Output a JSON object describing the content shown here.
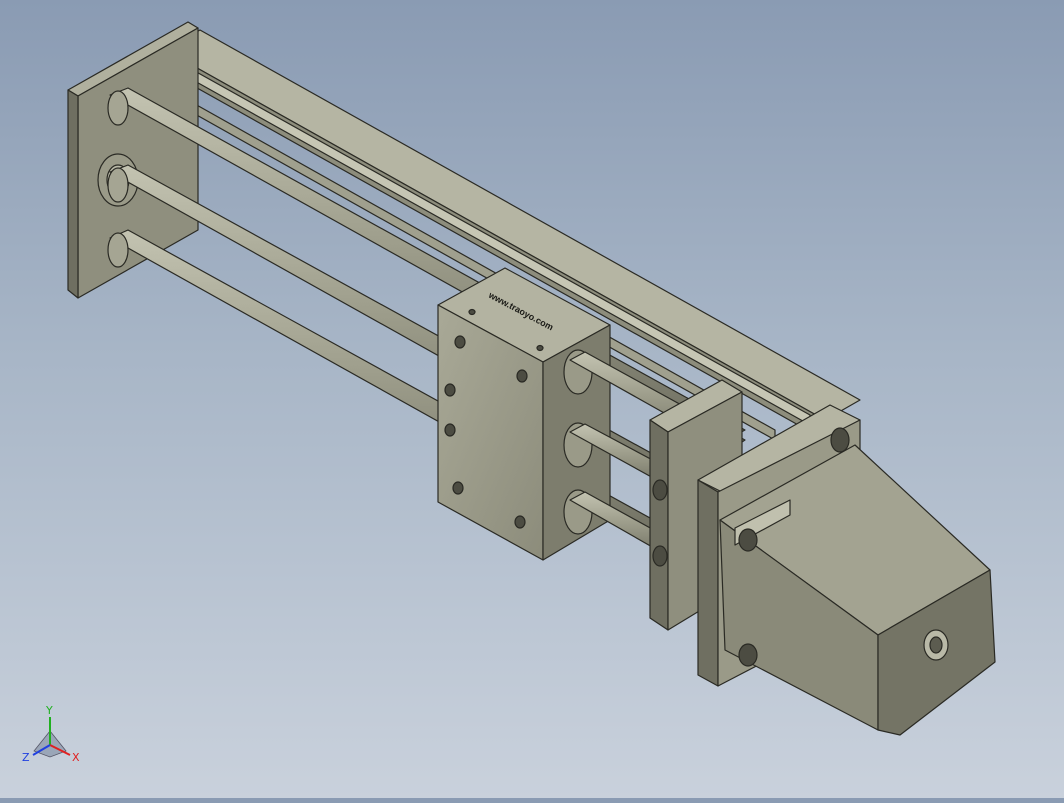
{
  "viewport": {
    "model_label": "www.traoyo.com",
    "colors": {
      "background_top": "#8a9bb3",
      "background_bottom": "#c9d1dc",
      "part_light": "#a7a795",
      "part_mid": "#8f8f7e",
      "part_dark": "#6f6f61",
      "edge": "#2a2a24"
    }
  },
  "triad": {
    "x_label": "X",
    "y_label": "Y",
    "z_label": "Z",
    "x_color": "#e02020",
    "y_color": "#20b020",
    "z_color": "#2040e0"
  }
}
